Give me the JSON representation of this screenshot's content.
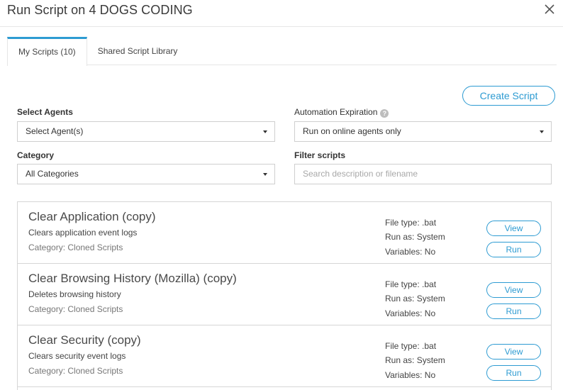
{
  "modal": {
    "title": "Run Script on 4 DOGS CODING"
  },
  "tabs": [
    {
      "label": "My Scripts (10)",
      "active": true
    },
    {
      "label": "Shared Script Library",
      "active": false
    }
  ],
  "actions": {
    "create_label": "Create Script"
  },
  "form": {
    "agents_label": "Select Agents",
    "agents_value": "Select Agent(s)",
    "expiration_label": "Automation Expiration",
    "expiration_value": "Run on online agents only",
    "category_label": "Category",
    "category_value": "All Categories",
    "filter_label": "Filter scripts",
    "filter_placeholder": "Search description or filename"
  },
  "scripts": [
    {
      "name": "Clear Application (copy)",
      "description": "Clears application event logs",
      "category": "Category: Cloned Scripts",
      "file_type": "File type: .bat",
      "run_as": "Run as: System",
      "variables": "Variables: No",
      "view_label": "View",
      "run_label": "Run"
    },
    {
      "name": "Clear Browsing History (Mozilla) (copy)",
      "description": "Deletes browsing history",
      "category": "Category: Cloned Scripts",
      "file_type": "File type: .bat",
      "run_as": "Run as: System",
      "variables": "Variables: No",
      "view_label": "View",
      "run_label": "Run"
    },
    {
      "name": "Clear Security (copy)",
      "description": "Clears security event logs",
      "category": "Category: Cloned Scripts",
      "file_type": "File type: .bat",
      "run_as": "Run as: System",
      "variables": "Variables: No",
      "view_label": "View",
      "run_label": "Run"
    }
  ],
  "colors": {
    "accent": "#2d9bd2",
    "border": "#d6d6d6"
  },
  "icons": {
    "close": "close-icon",
    "help": "help-icon",
    "caret": "chevron-down-icon"
  }
}
